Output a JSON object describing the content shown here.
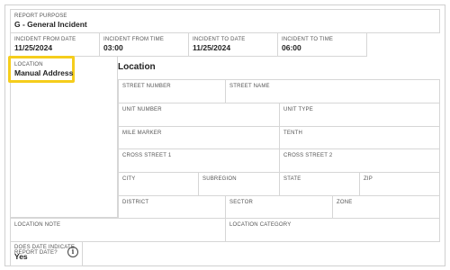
{
  "report_purpose": {
    "label": "REPORT PURPOSE",
    "value": "G - General Incident"
  },
  "dates": [
    {
      "label": "INCIDENT FROM DATE",
      "value": "11/25/2024"
    },
    {
      "label": "INCIDENT FROM TIME",
      "value": "03:00"
    },
    {
      "label": "INCIDENT TO DATE",
      "value": "11/25/2024"
    },
    {
      "label": "INCIDENT TO TIME",
      "value": "06:00"
    }
  ],
  "location_field": {
    "label": "LOCATION",
    "value": "Manual Address"
  },
  "location_section": {
    "title": "Location",
    "street_number": "STREET NUMBER",
    "street_name": "STREET NAME",
    "unit_number": "UNIT NUMBER",
    "unit_type": "UNIT TYPE",
    "mile_marker": "MILE MARKER",
    "tenth": "TENTH",
    "cross_street_1": "CROSS STREET 1",
    "cross_street_2": "CROSS STREET 2",
    "city": "CITY",
    "subregion": "SUBREGION",
    "state": "STATE",
    "zip": "ZIP",
    "district": "DISTRICT",
    "sector": "SECTOR",
    "zone": "ZONE"
  },
  "location_note": {
    "label": "LOCATION NOTE"
  },
  "location_category": {
    "label": "LOCATION CATEGORY"
  },
  "date_indicator": {
    "label_line1": "DOES DATE INDICATE",
    "label_line2": "REPORT DATE?",
    "value": "Yes",
    "icon": "info-icon"
  },
  "colors": {
    "highlight": "#f5cd1c",
    "border": "#d6d6d6"
  }
}
